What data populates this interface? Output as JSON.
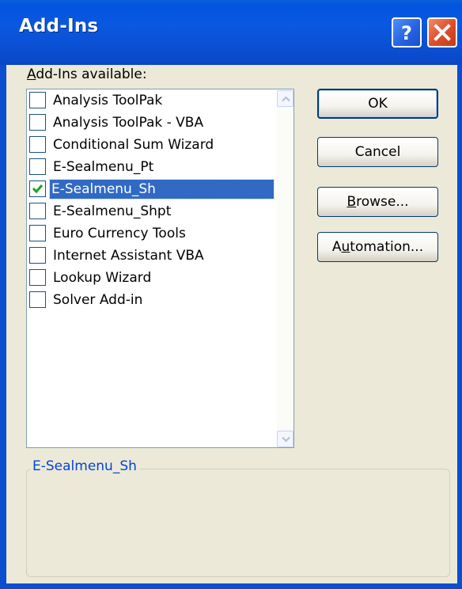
{
  "window": {
    "title": "Add-Ins"
  },
  "titlebar": {
    "help_icon": "question-mark-icon",
    "close_icon": "x-close-icon"
  },
  "list": {
    "label": "Add-Ins available:",
    "items": [
      {
        "label": "Analysis ToolPak",
        "checked": false,
        "selected": false
      },
      {
        "label": "Analysis ToolPak - VBA",
        "checked": false,
        "selected": false
      },
      {
        "label": "Conditional Sum Wizard",
        "checked": false,
        "selected": false
      },
      {
        "label": "E-Sealmenu_Pt",
        "checked": false,
        "selected": false
      },
      {
        "label": "E-Sealmenu_Sh",
        "checked": true,
        "selected": true
      },
      {
        "label": "E-Sealmenu_Shpt",
        "checked": false,
        "selected": false
      },
      {
        "label": "Euro Currency Tools",
        "checked": false,
        "selected": false
      },
      {
        "label": "Internet Assistant VBA",
        "checked": false,
        "selected": false
      },
      {
        "label": "Lookup Wizard",
        "checked": false,
        "selected": false
      },
      {
        "label": "Solver Add-in",
        "checked": false,
        "selected": false
      }
    ]
  },
  "buttons": {
    "ok": "OK",
    "cancel": "Cancel",
    "browse": "Browse...",
    "automation": "Automation..."
  },
  "description": {
    "title": "E-Sealmenu_Sh",
    "text": ""
  },
  "colors": {
    "titlebar": "#0a58e0",
    "selection": "#316ac5",
    "face": "#ece9d8",
    "group_title": "#0046d5",
    "check": "#21a121"
  }
}
